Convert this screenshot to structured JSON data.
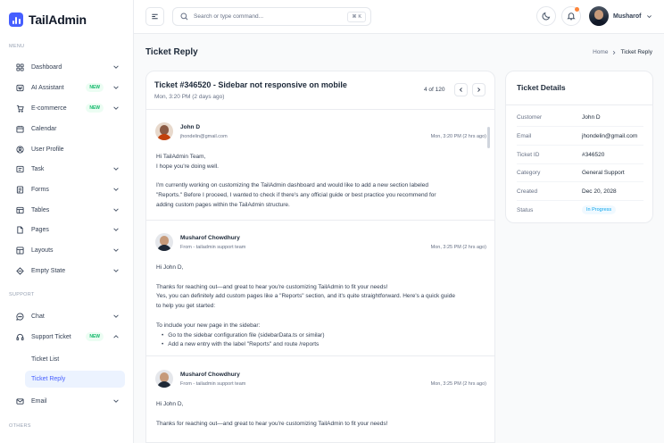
{
  "app": {
    "name": "TailAdmin",
    "brand_color": "#465fff"
  },
  "sidebar": {
    "menu_label": "MENU",
    "support_label": "SUPPORT",
    "others_label": "OTHERS",
    "items": [
      {
        "label": "Dashboard",
        "icon": "grid-icon"
      },
      {
        "label": "AI Assistant",
        "icon": "sparkle-icon",
        "badge": "NEW"
      },
      {
        "label": "E-commerce",
        "icon": "cart-icon",
        "badge": "NEW"
      },
      {
        "label": "Calendar",
        "icon": "calendar-icon"
      },
      {
        "label": "User Profile",
        "icon": "user-icon"
      },
      {
        "label": "Task",
        "icon": "task-icon"
      },
      {
        "label": "Forms",
        "icon": "form-icon"
      },
      {
        "label": "Tables",
        "icon": "table-icon"
      },
      {
        "label": "Pages",
        "icon": "pages-icon"
      },
      {
        "label": "Layouts",
        "icon": "layout-icon"
      },
      {
        "label": "Empty State",
        "icon": "empty-icon"
      }
    ],
    "support_items": [
      {
        "label": "Chat",
        "icon": "chat-icon"
      },
      {
        "label": "Support Ticket",
        "icon": "headset-icon",
        "badge": "NEW"
      },
      {
        "label": "Email",
        "icon": "mail-icon"
      }
    ],
    "sub_items": [
      {
        "label": "Ticket List"
      },
      {
        "label": "Ticket Reply"
      }
    ]
  },
  "header": {
    "search_placeholder": "Search or type command...",
    "shortcut": "⌘ K",
    "user_name": "Musharof"
  },
  "page": {
    "title": "Ticket Reply",
    "breadcrumb_home": "Home",
    "breadcrumb_current": "Ticket Reply"
  },
  "ticket": {
    "title": "Ticket #346520 - Sidebar not responsive on mobile",
    "date": "Mon, 3:20 PM (2 days ago)",
    "count": "4 of 120",
    "messages": [
      {
        "name": "John D",
        "sub": "jhondelin@gmail.com",
        "time": "Mon, 3:20 PM (2 hrs ago)",
        "greeting1": "Hi TailAdmin Team,",
        "greeting2": "I hope you're doing well.",
        "para1": "I'm currently working on customizing the TailAdmin dashboard and would like to add a new section labeled",
        "para2": "\"Reports.\" Before I proceed, I wanted to check if there's any official guide or best practice you recommend for",
        "para3": "adding custom pages within the TailAdmin structure."
      },
      {
        "name": "Musharof Chowdhury",
        "sub": "From - tailadmin support team",
        "time": "Mon, 3:25 PM (2 hrs ago)",
        "greeting": "Hi John D,",
        "para1": "Thanks for reaching out—and great to hear you're customizing TailAdmin to fit your needs!",
        "para2": "Yes, you can definitely add custom pages like a \"Reports\" section, and it's quite straightforward. Here's a quick guide",
        "para3": "to help you get started:",
        "list_intro": "To include your new page in the sidebar:",
        "bullet1": "Go to the sidebar configuration file (sidebarData.ts or similar)",
        "bullet2": "Add a new entry with the label \"Reports\" and route /reports"
      },
      {
        "name": "Musharof Chowdhury",
        "sub": "From - tailadmin support team",
        "time": "Mon, 3:25 PM (2 hrs ago)",
        "greeting": "Hi John D,",
        "para1": "Thanks for reaching out—and great to hear you're customizing TailAdmin to fit your needs!"
      }
    ]
  },
  "details": {
    "title": "Ticket Details",
    "rows": [
      {
        "key": "Customer",
        "value": "John D"
      },
      {
        "key": "Email",
        "value": "jhondelin@gmail.com"
      },
      {
        "key": "Ticket ID",
        "value": "#346520"
      },
      {
        "key": "Category",
        "value": "General Support"
      },
      {
        "key": "Created",
        "value": "Dec 20, 2028"
      },
      {
        "key": "Status",
        "value": "In Progress"
      }
    ]
  }
}
